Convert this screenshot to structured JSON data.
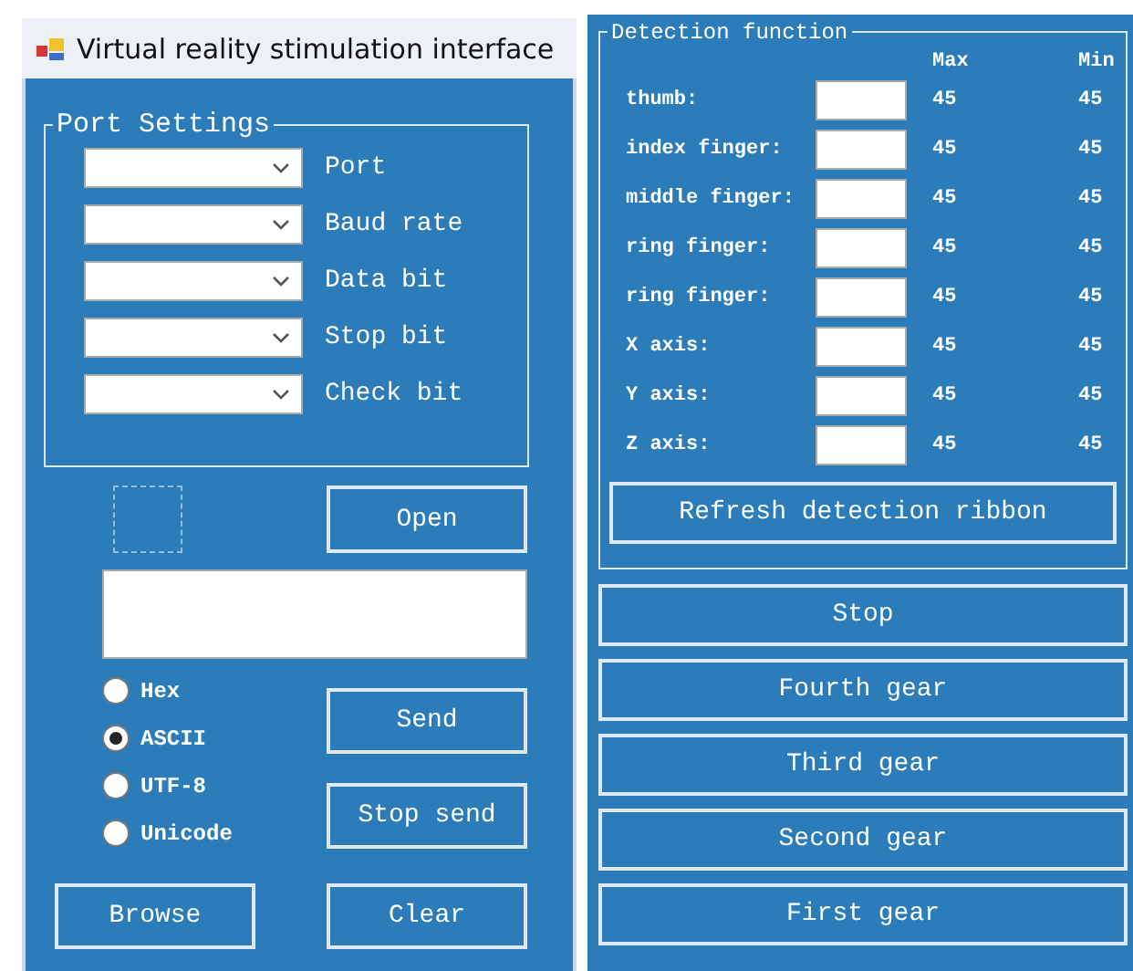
{
  "window": {
    "title": "Virtual reality stimulation interface"
  },
  "port_settings": {
    "title": "Port Settings",
    "fields": [
      {
        "label": "Port"
      },
      {
        "label": "Baud rate"
      },
      {
        "label": "Data bit"
      },
      {
        "label": "Stop bit"
      },
      {
        "label": "Check bit"
      }
    ]
  },
  "encodings": [
    {
      "label": "Hex",
      "selected": false
    },
    {
      "label": "ASCII",
      "selected": true
    },
    {
      "label": "UTF-8",
      "selected": false
    },
    {
      "label": "Unicode",
      "selected": false
    }
  ],
  "buttons": {
    "open": "Open",
    "send": "Send",
    "stop_send": "Stop send",
    "browse": "Browse",
    "clear": "Clear"
  },
  "detection": {
    "title": "Detection function",
    "columns": [
      "Max",
      "Min"
    ],
    "rows": [
      {
        "label": "thumb:",
        "max": "45",
        "min": "45"
      },
      {
        "label": "index finger:",
        "max": "45",
        "min": "45"
      },
      {
        "label": "middle finger:",
        "max": "45",
        "min": "45"
      },
      {
        "label": "ring finger:",
        "max": "45",
        "min": "45"
      },
      {
        "label": "ring finger:",
        "max": "45",
        "min": "45"
      },
      {
        "label": "X axis:",
        "max": "45",
        "min": "45"
      },
      {
        "label": "Y axis:",
        "max": "45",
        "min": "45"
      },
      {
        "label": "Z axis:",
        "max": "45",
        "min": "45"
      }
    ],
    "refresh": "Refresh detection ribbon"
  },
  "gears": [
    "Stop",
    "Fourth gear",
    "Third gear",
    "Second gear",
    "First gear"
  ]
}
